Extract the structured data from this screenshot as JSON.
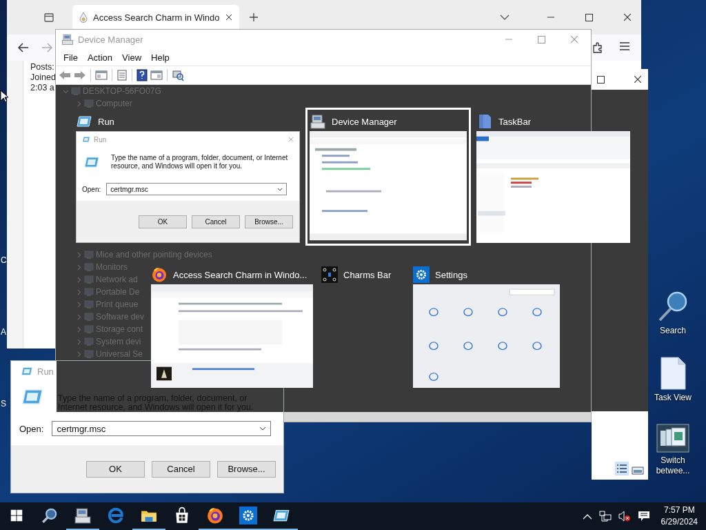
{
  "desktop": {
    "edge_labels": [
      "C",
      "A",
      "S"
    ],
    "icons": [
      {
        "label": "Search",
        "kind": "search"
      },
      {
        "label": "Task View",
        "kind": "document"
      },
      {
        "label": "Switch betwee...",
        "kind": "windows"
      }
    ]
  },
  "browser": {
    "tab": {
      "title": "Access Search Charm in Windo"
    },
    "page_lines": [
      "Posts:",
      "Joined",
      "2:03 a"
    ]
  },
  "device_manager": {
    "title": "Device Manager",
    "menu": [
      "File",
      "Action",
      "View",
      "Help"
    ],
    "tree": {
      "label": "DESKTOP-56FO07G",
      "expanded": true,
      "children": [
        {
          "label": "Computer",
          "expanded": false
        },
        {
          "label": "Mice and other pointing devices",
          "expanded": false
        },
        {
          "label": "Monitors",
          "expanded": false
        },
        {
          "label": "Network ad",
          "expanded": false
        },
        {
          "label": "Portable De",
          "expanded": false
        },
        {
          "label": "Print queue",
          "expanded": false
        },
        {
          "label": "Software dev",
          "expanded": false
        },
        {
          "label": "Storage cont",
          "expanded": false
        },
        {
          "label": "System devi",
          "expanded": false
        },
        {
          "label": "Universal Se",
          "expanded": false
        }
      ]
    }
  },
  "run_dialog": {
    "title": "Run",
    "message": "Type the name of a program, folder, document, or Internet resource, and Windows will open it for you.",
    "open_label": "Open:",
    "value": "certmgr.msc",
    "buttons": [
      "OK",
      "Cancel",
      "Browse..."
    ]
  },
  "task_switcher": {
    "rows": [
      [
        {
          "title": "Run",
          "kind": "run",
          "selected": false,
          "preview": {
            "kind": "run-dialog",
            "title": "Run",
            "message": "Type the name of a program, folder, document, or Internet resource, and Windows will open it for you.",
            "open_label": "Open:",
            "value": "certmgr.msc",
            "buttons": [
              "OK",
              "Cancel",
              "Browse..."
            ]
          }
        },
        {
          "title": "Device Manager",
          "kind": "device-manager",
          "selected": true
        },
        {
          "title": "TaskBar",
          "kind": "folder",
          "selected": false
        }
      ],
      [
        {
          "title": "Access Search Charm in Windo...",
          "kind": "firefox",
          "selected": false
        },
        {
          "title": "Charms Bar",
          "kind": "charms",
          "selected": false
        },
        {
          "title": "Settings",
          "kind": "settings",
          "selected": false
        }
      ]
    ]
  },
  "taskbar": {
    "apps": [
      {
        "kind": "start",
        "running": false
      },
      {
        "kind": "search",
        "running": false
      },
      {
        "kind": "device-manager",
        "running": true
      },
      {
        "kind": "edge",
        "running": false
      },
      {
        "kind": "explorer",
        "running": true
      },
      {
        "kind": "store",
        "running": false
      },
      {
        "kind": "firefox",
        "running": true
      },
      {
        "kind": "settings",
        "running": true
      },
      {
        "kind": "run",
        "running": true
      }
    ],
    "clock": {
      "time": "7:57 PM",
      "date": "6/29/2024"
    }
  }
}
